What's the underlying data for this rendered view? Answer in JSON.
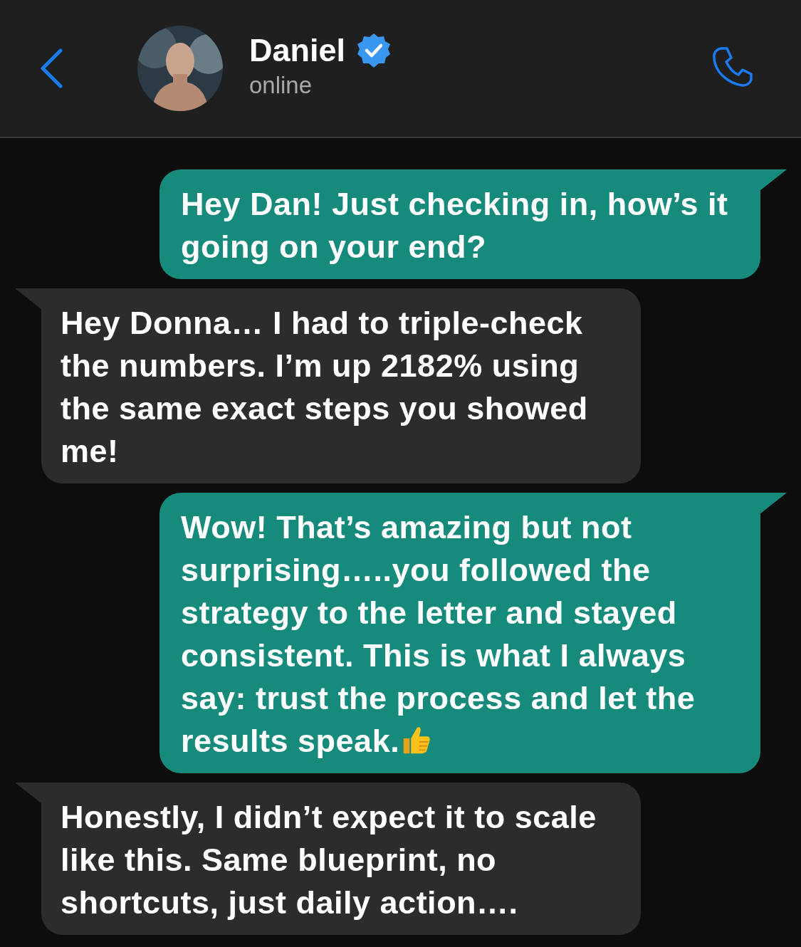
{
  "header": {
    "contact": {
      "name": "Daniel",
      "verified": true,
      "status": "online"
    }
  },
  "messages": [
    {
      "kind": "outgoing",
      "text": "Hey Dan! Just checking in, how’s it going on your end?"
    },
    {
      "kind": "incoming",
      "text": "Hey Donna… I had to triple-check the numbers. I’m up 2182% using the same exact steps you showed me!"
    },
    {
      "kind": "outgoing",
      "text": "Wow! That’s amazing but not surprising…..you followed the strategy to the letter and stayed consistent. This is what I always say: trust the process and let the results speak.",
      "ends_with_thumbs_up": true
    },
    {
      "kind": "incoming",
      "text": "Honestly, I didn’t expect it to scale like this. Same blueprint, no shortcuts, just daily action…."
    }
  ]
}
